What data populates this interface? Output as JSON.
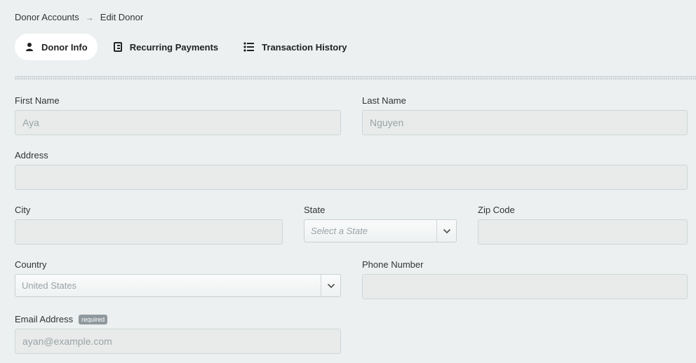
{
  "breadcrumb": {
    "parent": "Donor Accounts",
    "separator": "→",
    "current": "Edit Donor"
  },
  "tabs": [
    {
      "label": "Donor Info",
      "icon": "person-icon",
      "active": true
    },
    {
      "label": "Recurring Payments",
      "icon": "address-book-icon",
      "active": false
    },
    {
      "label": "Transaction History",
      "icon": "list-icon",
      "active": false
    }
  ],
  "form": {
    "first_name": {
      "label": "First Name",
      "value": "Aya"
    },
    "last_name": {
      "label": "Last Name",
      "value": "Nguyen"
    },
    "address": {
      "label": "Address",
      "value": ""
    },
    "city": {
      "label": "City",
      "value": ""
    },
    "state": {
      "label": "State",
      "placeholder": "Select a State"
    },
    "zip": {
      "label": "Zip Code",
      "value": ""
    },
    "country": {
      "label": "Country",
      "value": "United States"
    },
    "phone": {
      "label": "Phone Number",
      "value": ""
    },
    "email": {
      "label": "Email Address",
      "badge": "required",
      "value": "ayan@example.com"
    }
  },
  "colors": {
    "background": "#ecf0f1",
    "input_bg": "#e8ebea",
    "badge": "#8f989c"
  }
}
